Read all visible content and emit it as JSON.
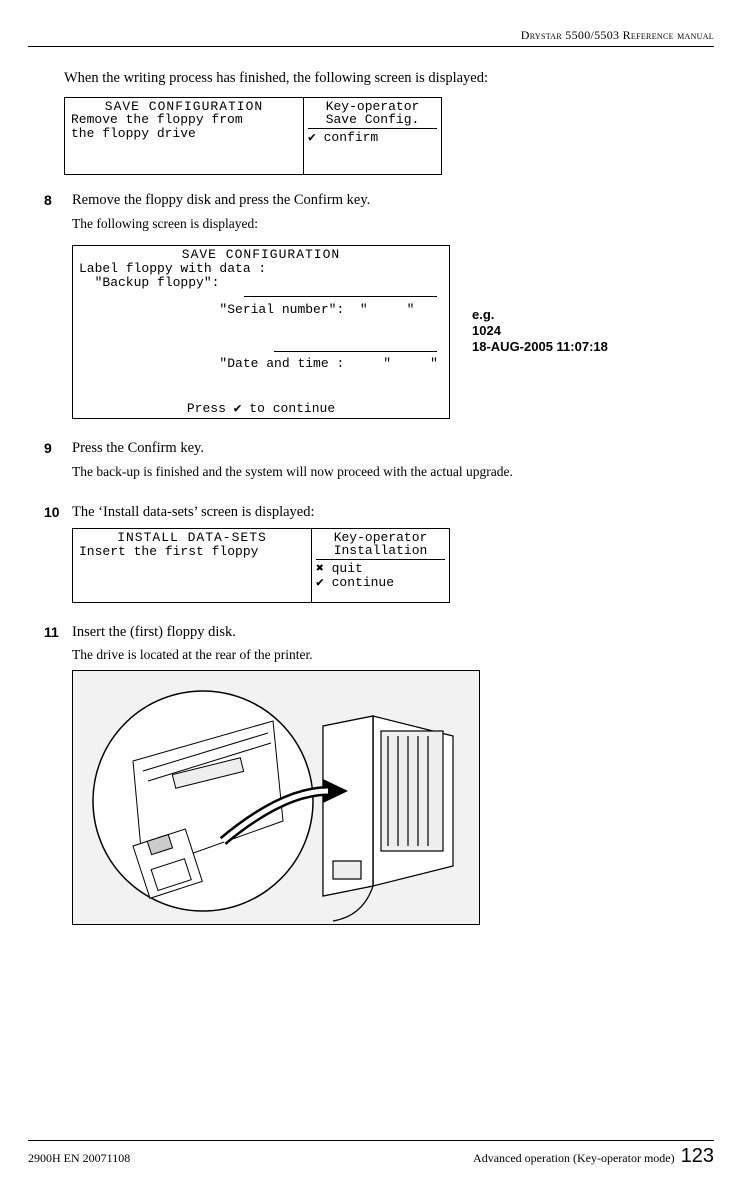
{
  "header": {
    "title": "Drystar 5500/5503 Reference manual"
  },
  "intro": "When the writing process has finished, the following screen is displayed:",
  "screen1": {
    "title": "SAVE CONFIGURATION",
    "body": "Remove the floppy from\nthe floppy drive",
    "right_top": "Key-operator\nSave Config.",
    "right_bottom_sym": "✔",
    "right_bottom_text": " confirm"
  },
  "step8": {
    "num": "8",
    "title": "Remove the floppy disk and press the Confirm key.",
    "sub": "The following screen is displayed:"
  },
  "screen2": {
    "title": "SAVE CONFIGURATION",
    "line1": "Label floppy with data :",
    "line2": "  \"Backup floppy\":",
    "line3": "  \"Serial number\":  \"     \"",
    "line4": "  \"Date and time :     \"     \"",
    "footer": "Press ✔ to continue",
    "note": "e.g.\n1024\n18-AUG-2005 11:07:18"
  },
  "step9": {
    "num": "9",
    "title": "Press the Confirm key.",
    "sub": "The back-up is finished and the system will now proceed with the actual upgrade."
  },
  "step10": {
    "num": "10",
    "title": "The ‘Install data-sets’ screen is displayed:"
  },
  "screen3": {
    "title": "INSTALL DATA-SETS",
    "body": "Insert the first floppy",
    "right_top": "Key-operator\nInstallation",
    "right_line1_sym": "✖",
    "right_line1_text": " quit",
    "right_line2_sym": "✔",
    "right_line2_text": " continue"
  },
  "step11": {
    "num": "11",
    "title": "Insert the (first) floppy disk.",
    "sub": "The drive is located at the rear of the printer."
  },
  "footer": {
    "left": "2900H EN 20071108",
    "right": "Advanced operation (Key-operator mode)",
    "page": "123"
  }
}
